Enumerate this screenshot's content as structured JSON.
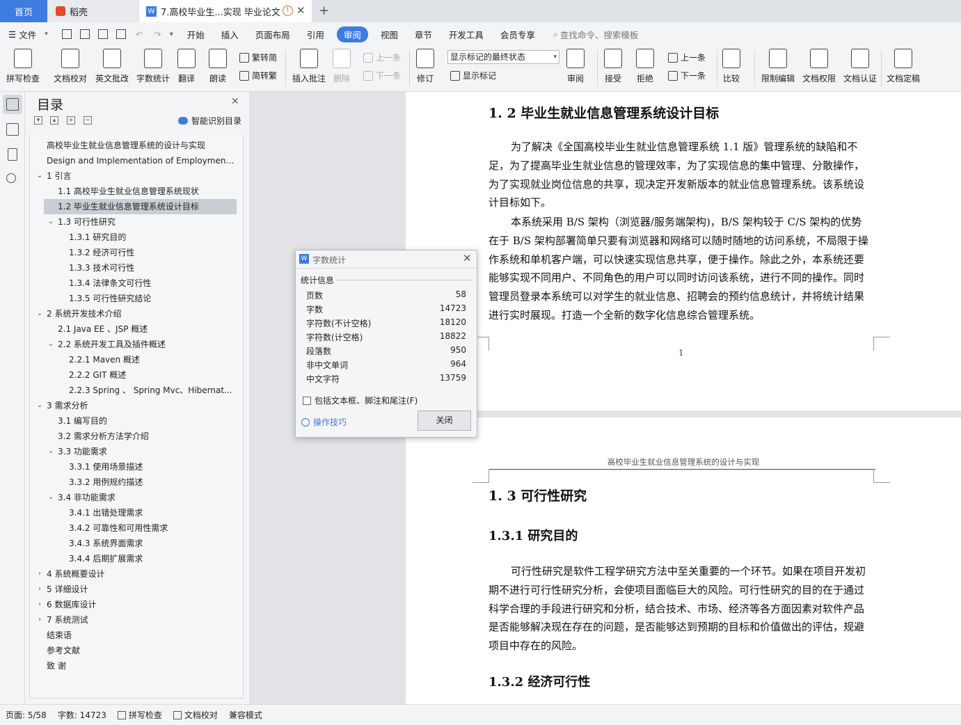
{
  "tabs": {
    "home": "首页",
    "daoke": "稻壳",
    "doc": "7.高校毕业生...实现 毕业论文",
    "new_tab": "+"
  },
  "menu": {
    "file": "文件",
    "items": [
      "开始",
      "插入",
      "页面布局",
      "引用",
      "审阅",
      "视图",
      "章节",
      "开发工具",
      "会员专享"
    ],
    "active": "审阅",
    "search": "查找命令、搜索模板"
  },
  "ribbon": {
    "spellcheck": "拼写检查",
    "proofread": "文档校对",
    "en_review": "英文批改",
    "wordcount": "字数统计",
    "translate": "翻译",
    "read_aloud": "朗读",
    "trad": "繁转简",
    "simp": "简转繁",
    "insert_comment": "插入批注",
    "delete": "删除",
    "prev": "上一条",
    "next": "下一条",
    "revise": "修订",
    "markup_state": "显示标记的最终状态",
    "show_markup": "显示标记",
    "review": "审阅",
    "accept": "接受",
    "reject": "拒绝",
    "prev_change": "上一条",
    "next_change": "下一条",
    "compare": "比较",
    "restrict": "限制编辑",
    "permission": "文档权限",
    "certify": "文档认证",
    "finalize": "文档定稿"
  },
  "toc": {
    "title": "目录",
    "smart": "智能识别目录",
    "items": [
      {
        "text": "高校毕业生就业信息管理系统的设计与实现",
        "level": 0,
        "arrow": ""
      },
      {
        "text": "Design and Implementation of Employment...",
        "level": 0,
        "arrow": ""
      },
      {
        "text": "1   引言",
        "level": 0,
        "arrow": "v"
      },
      {
        "text": "1.1    高校毕业生就业信息管理系统现状",
        "level": 1,
        "arrow": ""
      },
      {
        "text": "1.2 毕业生就业信息管理系统设计目标",
        "level": 1,
        "arrow": "",
        "selected": true
      },
      {
        "text": "1.3  可行性研究",
        "level": 1,
        "arrow": "v"
      },
      {
        "text": "1.3.1  研究目的",
        "level": 2,
        "arrow": ""
      },
      {
        "text": "1.3.2  经济可行性",
        "level": 2,
        "arrow": ""
      },
      {
        "text": "1.3.3  技术可行性",
        "level": 2,
        "arrow": ""
      },
      {
        "text": "1.3.4 法律条文可行性",
        "level": 2,
        "arrow": ""
      },
      {
        "text": "1.3.5 可行性研究结论",
        "level": 2,
        "arrow": ""
      },
      {
        "text": "2   系统开发技术介绍",
        "level": 0,
        "arrow": "v"
      },
      {
        "text": "2.1    Java EE 、JSP 概述",
        "level": 1,
        "arrow": ""
      },
      {
        "text": "2.2 系统开发工具及插件概述",
        "level": 1,
        "arrow": "v"
      },
      {
        "text": "2.2.1 Maven  概述",
        "level": 2,
        "arrow": ""
      },
      {
        "text": "2.2.2 GIT  概述",
        "level": 2,
        "arrow": ""
      },
      {
        "text": "2.2.3 Spring 、 Spring Mvc、Hibernat...",
        "level": 2,
        "arrow": ""
      },
      {
        "text": "3     需求分析",
        "level": 0,
        "arrow": "v"
      },
      {
        "text": "3.1  编写目的",
        "level": 1,
        "arrow": ""
      },
      {
        "text": "3.2  需求分析方法学介绍",
        "level": 1,
        "arrow": ""
      },
      {
        "text": "3.3 功能需求",
        "level": 1,
        "arrow": "v"
      },
      {
        "text": "3.3.1 使用场景描述",
        "level": 2,
        "arrow": ""
      },
      {
        "text": "3.3.2 用例规约描述",
        "level": 2,
        "arrow": ""
      },
      {
        "text": "3.4  非功能需求",
        "level": 1,
        "arrow": "v"
      },
      {
        "text": "3.4.1  出错处理需求",
        "level": 2,
        "arrow": ""
      },
      {
        "text": "3.4.2  可靠性和可用性需求",
        "level": 2,
        "arrow": ""
      },
      {
        "text": "3.4.3  系统界面需求",
        "level": 2,
        "arrow": ""
      },
      {
        "text": "3.4.4  后期扩展需求",
        "level": 2,
        "arrow": ""
      },
      {
        "text": "4     系统概要设计",
        "level": 0,
        "arrow": ">"
      },
      {
        "text": "5  详细设计",
        "level": 0,
        "arrow": ">"
      },
      {
        "text": "6  数据库设计",
        "level": 0,
        "arrow": ">"
      },
      {
        "text": "7  系统测试",
        "level": 0,
        "arrow": ">"
      },
      {
        "text": "结束语",
        "level": 0,
        "arrow": ""
      },
      {
        "text": "参考文献",
        "level": 0,
        "arrow": ""
      },
      {
        "text": "致   谢",
        "level": 0,
        "arrow": ""
      }
    ]
  },
  "doc": {
    "h_1_2": "1. 2 毕业生就业信息管理系统设计目标",
    "p1": "为了解决《全国高校毕业生就业信息管理系统 1.1 版》管理系统的缺陷和不足，为了提高毕业生就业信息的管理效率，为了实现信息的集中管理、分散操作，为了实现就业岗位信息的共享，现决定开发新版本的就业信息管理系统。该系统设计目标如下。",
    "p2": "本系统采用 B/S 架构（浏览器/服务端架构)，B/S 架构较于 C/S 架构的优势在于 B/S 架构部署简单只要有浏览器和网络可以随时随地的访问系统，不局限于操作系统和单机客户端，可以快速实现信息共享，便于操作。除此之外，本系统还要能够实现不同用户、不同角色的用户可以同时访问该系统，进行不同的操作。同时管理员登录本系统可以对学生的就业信息、招聘会的预约信息统计，并将统计结果进行实时展现。打造一个全新的数字化信息综合管理系统。",
    "page_num": "1",
    "header": "高校毕业生就业信息管理系统的设计与实现",
    "h_1_3": "1. 3  可行性研究",
    "h_1_3_1": "1.3.1  研究目的",
    "p3": "可行性研究是软件工程学研究方法中至关重要的一个环节。如果在项目开发初期不进行可行性研究分析，会使项目面临巨大的风险。可行性研究的目的在于通过科学合理的手段进行研究和分析，结合技术、市场、经济等各方面因素对软件产品是否能够解决现在存在的问题，是否能够达到预期的目标和价值做出的评估，规避项目中存在的风险。",
    "h_1_3_2": "1.3.2  经济可行性"
  },
  "dialog": {
    "title": "字数统计",
    "section": "统计信息",
    "stats": [
      {
        "label": "页数",
        "value": "58"
      },
      {
        "label": "字数",
        "value": "14723"
      },
      {
        "label": "字符数(不计空格)",
        "value": "18120"
      },
      {
        "label": "字符数(计空格)",
        "value": "18822"
      },
      {
        "label": "段落数",
        "value": "950"
      },
      {
        "label": "非中文单词",
        "value": "964"
      },
      {
        "label": "中文字符",
        "value": "13759"
      }
    ],
    "checkbox": "包括文本框、脚注和尾注(F)",
    "tips": "操作技巧",
    "close": "关闭"
  },
  "status": {
    "page": "页面: 5/58",
    "words": "字数: 14723",
    "spell": "拼写检查",
    "proof": "文档校对",
    "compat": "兼容模式"
  },
  "colors": {
    "accent": "#3d7ce0",
    "selection": "#c9ced5"
  }
}
